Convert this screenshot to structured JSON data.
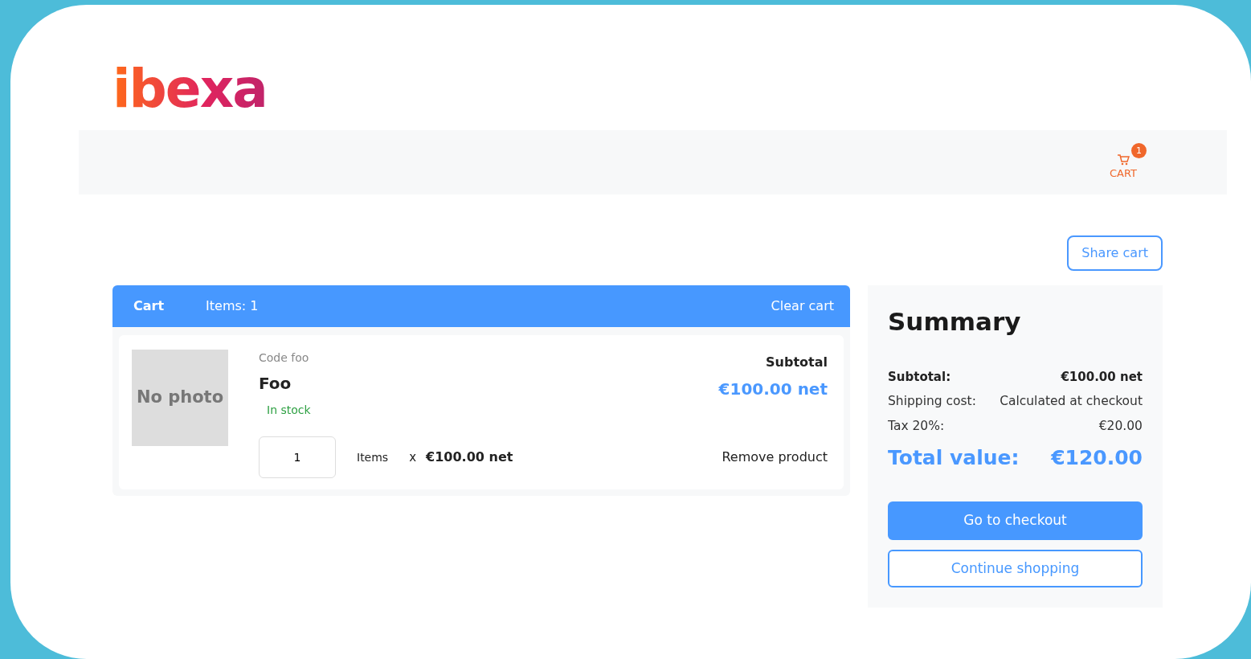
{
  "logo": {
    "text": "ibexa"
  },
  "header": {
    "cart_link": {
      "label": "CART",
      "badge": "1"
    }
  },
  "share_button": {
    "label": "Share cart"
  },
  "cart": {
    "title": "Cart",
    "items_count": "Items: 1",
    "clear": "Clear cart",
    "products": [
      {
        "image": "No photo",
        "code": "Code foo",
        "name": "Foo",
        "stock": "In stock",
        "in_stock": true,
        "subtotal_label": "Subtotal",
        "subtotal": "€100.00 net",
        "quantity": "1",
        "unit": "Items",
        "times": "x",
        "unit_price": "€100.00 net",
        "remove": "Remove product"
      }
    ]
  },
  "summary": {
    "title": "Summary",
    "rows": [
      {
        "kind": "bold",
        "label": "Subtotal:",
        "value": "€100.00 net"
      },
      {
        "kind": "plain",
        "label": "Shipping cost:",
        "value": "Calculated at checkout"
      },
      {
        "kind": "plain",
        "label": "Tax 20%:",
        "value": "€20.00"
      },
      {
        "kind": "total",
        "label": "Total value:",
        "value": "€120.00"
      }
    ],
    "buttons": [
      {
        "kind": "primary",
        "label": "Go to checkout"
      },
      {
        "kind": "outline",
        "label": "Continue shopping"
      }
    ]
  }
}
